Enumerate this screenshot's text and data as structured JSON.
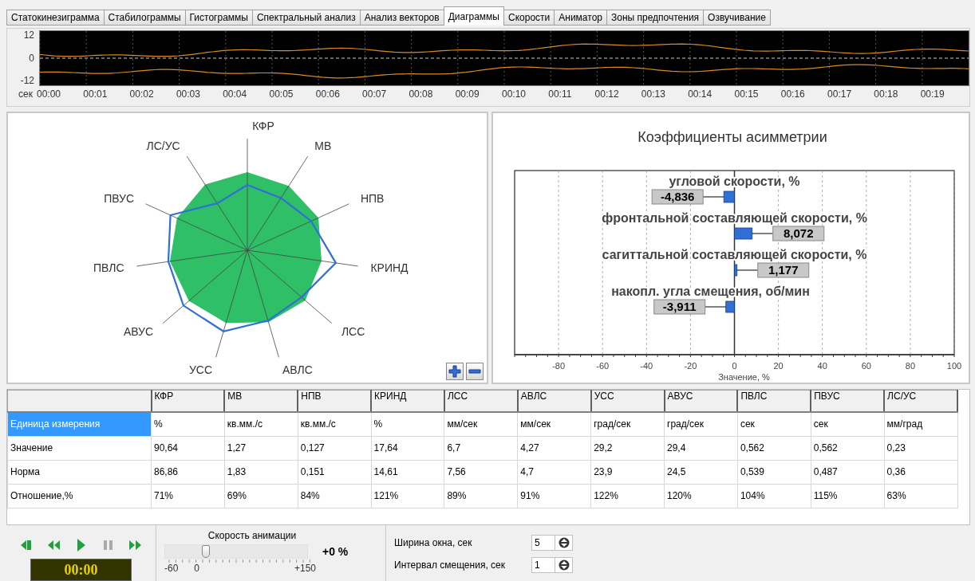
{
  "tabs": [
    {
      "label": "Статокинезиграмма",
      "selected": false
    },
    {
      "label": "Стабилограммы",
      "selected": false
    },
    {
      "label": "Гистограммы",
      "selected": false
    },
    {
      "label": "Спектральный анализ",
      "selected": false
    },
    {
      "label": "Анализ векторов",
      "selected": false
    },
    {
      "label": "Диаграммы",
      "selected": true
    },
    {
      "label": "Скорости",
      "selected": false
    },
    {
      "label": "Аниматор",
      "selected": false
    },
    {
      "label": "Зоны предпочтения",
      "selected": false
    },
    {
      "label": "Озвучивание",
      "selected": false
    }
  ],
  "signal_graph": {
    "y_labels": [
      "12",
      "0",
      "-12"
    ],
    "time_unit": "сек",
    "time_labels": [
      "00:00",
      "00:01",
      "00:02",
      "00:03",
      "00:04",
      "00:05",
      "00:06",
      "00:07",
      "00:08",
      "00:09",
      "00:10",
      "00:11",
      "00:12",
      "00:13",
      "00:14",
      "00:15",
      "00:16",
      "00:17",
      "00:18",
      "00:19"
    ]
  },
  "radar": {
    "axes": [
      "КФР",
      "МВ",
      "НПВ",
      "КРИНД",
      "ЛСС",
      "АВЛС",
      "УСС",
      "АВУС",
      "ПВЛС",
      "ПВУС",
      "ЛС/УС"
    ]
  },
  "asymmetry_chart": {
    "chart_data": {
      "type": "bar",
      "orientation": "horizontal",
      "title": "Коэффициенты асимметрии",
      "xlabel": "Значение, %",
      "categories": [
        "угловой скорости, %",
        "фронтальной составляющей скорости, %",
        "сагиттальной составляющей скорости, %",
        "накопл. угла смещения, об/мин"
      ],
      "values": [
        -4.836,
        8.072,
        1.177,
        -3.911
      ],
      "value_labels": [
        "-4,836",
        "8,072",
        "1,177",
        "-3,911"
      ],
      "xlim": [
        -100,
        100
      ],
      "grid": true,
      "xticks": [
        -80,
        -60,
        -40,
        -20,
        0,
        20,
        40,
        60,
        80,
        100
      ]
    }
  },
  "table": {
    "columns": [
      "КФР",
      "МВ",
      "НПВ",
      "КРИНД",
      "ЛСС",
      "АВЛС",
      "УСС",
      "АВУС",
      "ПВЛС",
      "ПВУС",
      "ЛС/УС"
    ],
    "rows": [
      {
        "label": "Единица измерения",
        "selected": true,
        "cells": [
          "%",
          "кв.мм./с",
          "кв.мм./с",
          "%",
          "мм/сек",
          "мм/сек",
          "град/сек",
          "град/сек",
          "сек",
          "сек",
          "мм/град"
        ]
      },
      {
        "label": "Значение",
        "selected": false,
        "cells": [
          "90,64",
          "1,27",
          "0,127",
          "17,64",
          "6,7",
          "4,27",
          "29,2",
          "29,4",
          "0,562",
          "0,562",
          "0,23"
        ]
      },
      {
        "label": "Норма",
        "selected": false,
        "cells": [
          "86,86",
          "1,83",
          "0,151",
          "14,61",
          "7,56",
          "4,7",
          "23,9",
          "24,5",
          "0,539",
          "0,487",
          "0,36"
        ]
      },
      {
        "label": "Отношение,%",
        "selected": false,
        "cells": [
          "71%",
          "69%",
          "84%",
          "121%",
          "89%",
          "91%",
          "122%",
          "120%",
          "104%",
          "115%",
          "63%"
        ]
      }
    ]
  },
  "player": {
    "time": "00:00"
  },
  "speed": {
    "label": "Скорость анимации",
    "level": 0.286,
    "reading": "+0 %",
    "scale": [
      "-60",
      "0",
      "+150"
    ]
  },
  "settings": [
    {
      "label": "Ширина окна, сек",
      "value": "5"
    },
    {
      "label": "Интервал смещения, сек",
      "value": "1"
    }
  ]
}
